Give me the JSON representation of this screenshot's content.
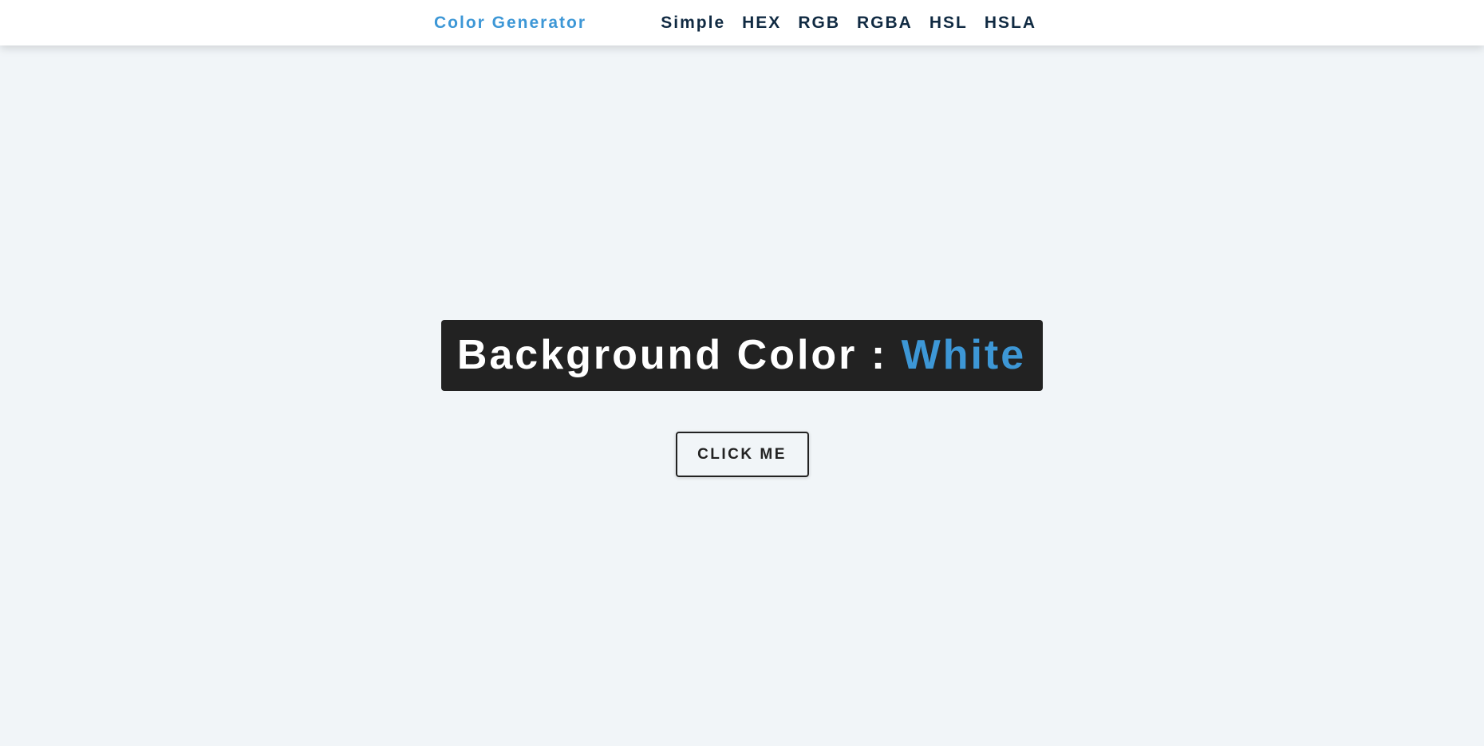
{
  "navbar": {
    "brand": "Color Generator",
    "links": [
      {
        "label": "Simple"
      },
      {
        "label": "HEX"
      },
      {
        "label": "RGB"
      },
      {
        "label": "RGBA"
      },
      {
        "label": "HSL"
      },
      {
        "label": "HSLA"
      }
    ]
  },
  "main": {
    "heading_prefix": "Background Color : ",
    "color_name": "White",
    "button_label": "CLICK ME"
  },
  "colors": {
    "page_background": "#f1f5f8",
    "accent": "#3d97d6",
    "nav_text": "#102a42",
    "box_background": "#222222"
  }
}
